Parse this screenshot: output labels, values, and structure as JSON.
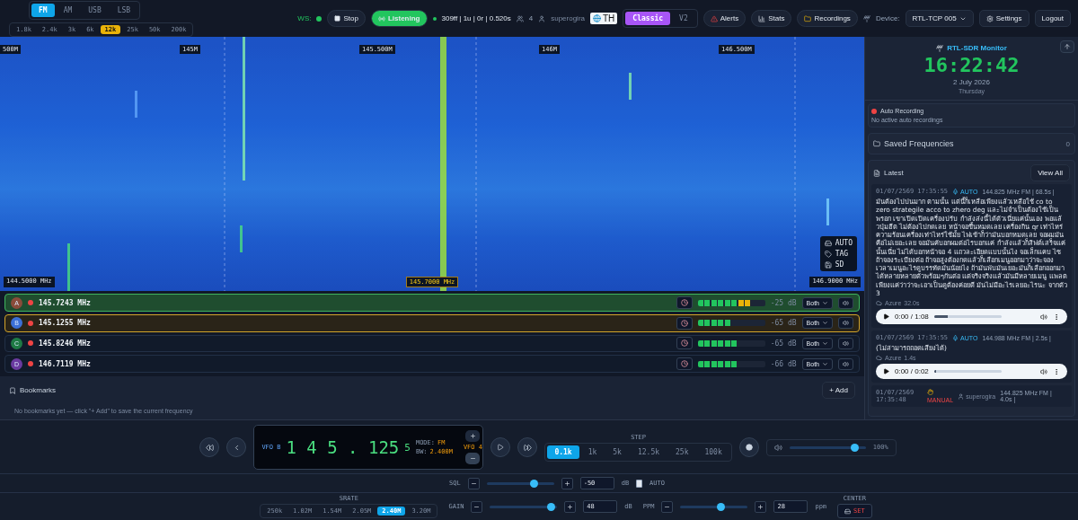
{
  "top_bar": {
    "modes": [
      {
        "label": "FM",
        "selected": true
      },
      {
        "label": "AM",
        "selected": false
      },
      {
        "label": "USB",
        "selected": false
      },
      {
        "label": "LSB",
        "selected": false
      }
    ],
    "bandwidths": [
      {
        "label": "1.8k",
        "selected": false
      },
      {
        "label": "2.4k",
        "selected": false
      },
      {
        "label": "3k",
        "selected": false
      },
      {
        "label": "6k",
        "selected": false
      },
      {
        "label": "12k",
        "selected": true
      },
      {
        "label": "25k",
        "selected": false
      },
      {
        "label": "50k",
        "selected": false
      },
      {
        "label": "200k",
        "selected": false
      }
    ],
    "ws": {
      "label": "WS:",
      "connected": true
    },
    "stop_button": "Stop",
    "listening_button": {
      "label": "Listening",
      "on": true
    },
    "stats": "309ff | 1u | 0r | 0.520s",
    "listeners": "4",
    "user": "superogira",
    "language": "TH",
    "ui_modes": [
      {
        "label": "Classic",
        "selected": true
      },
      {
        "label": "V2",
        "selected": false
      }
    ],
    "alerts_button": "Alerts",
    "stats_button": "Stats",
    "recordings_button": "Recordings",
    "device_label": "Device:",
    "device": "RTL-TCP 005",
    "settings_button": "Settings",
    "logout_button": "Logout"
  },
  "waterfall": {
    "scale_ticks": [
      "500M",
      "145M",
      "145.500M",
      "146M",
      "146.500M"
    ],
    "range_labels": [
      "144.5000 MHz",
      "145.7000 MHz",
      "146.9000 MHz"
    ],
    "legend": [
      "AUTO",
      "TAG",
      "SD"
    ]
  },
  "vfos": [
    {
      "letter": "A",
      "color": "#8a4b3a",
      "frequency": "145.7243 MHz",
      "recording": true,
      "squelch_open": true,
      "selected": false,
      "level": 0.8,
      "reading": "-25 dB",
      "output": "Both"
    },
    {
      "letter": "B",
      "color": "#3b6fd6",
      "frequency": "145.1255 MHz",
      "recording": true,
      "squelch_open": false,
      "selected": true,
      "level": 0.5,
      "reading": "-65 dB",
      "output": "Both"
    },
    {
      "letter": "C",
      "color": "#1e7a44",
      "frequency": "145.8246 MHz",
      "recording": true,
      "squelch_open": false,
      "selected": false,
      "level": 0.6,
      "reading": "-65 dB",
      "output": "Both"
    },
    {
      "letter": "D",
      "color": "#6a3aa0",
      "frequency": "146.7119 MHz",
      "recording": true,
      "squelch_open": false,
      "selected": false,
      "level": 0.6,
      "reading": "-66 dB",
      "output": "Both"
    }
  ],
  "bookmarks": {
    "title": "Bookmarks",
    "add_button": "+ Add",
    "empty_text": "No bookmarks yet — click \"+ Add\" to save the current frequency"
  },
  "sidebar": {
    "title": "RTL-SDR Monitor",
    "time": "16:22:42",
    "date": "2 July 2026",
    "weekday": "Thursday",
    "auto_recording": {
      "title": "Auto Recording",
      "active": true,
      "status": "No active auto recordings"
    },
    "saved_frequencies": {
      "title": "Saved Frequencies",
      "count": "0"
    },
    "latest": {
      "title": "Latest",
      "view_all": "View All",
      "items": [
        {
          "time": "01/07/2569 17:35:55",
          "kind": "auto",
          "source": "AUTO",
          "meta": "144.825 MHz FM | 68.5s |",
          "transcript": "มันต้องไปปนมาก ตามนั้น แต่นี้ก็เหลือเพียงแล้วเหลือใช้ co to zero strategile acco to zhero deg และไม่จำเป็นต้องใช้เป็นพรอก เขาเปิดเปิดเครื่องปรับ กำลังส่งนี้ได้ตัวเนี่ยแค่นั้นเอง พอแล้วปุ่มฮีต ไม่ต้องไปกดเลย หน้าจอขึ้นหมดเลย เครื่องกิน qr เท่าไหร่ความร้อนเครื่องเท่าไหร่ใช้มั้ย ไฟเข้าก็ว่ามันบอกหมดเลย จอผมมันคือไม่เยอะเลย จอมันคับอกผมต่อไรบอกแค่ กำลังแล้วก็สิฟต์เสร็จแค่นั้นเนี่ย ไม่ได้บอกหน้าจอ 4 แถวละเอียดแบบนั้นไง จอเล็กแคบ ไซ ถ้าจองระเบียงต่อ ถ้าจอสูงต้องกดแล้วก็เลือกเมนูออกมาว่าจะจองเวลาเมนูอะไรดูบรรทัดมันน้อยไง ถ้ามันพับมันเยอะมันก็เลือกออกมาได้หลายหลายตัวพร้อมๆกันต่อ แต่จริงจริงแล้วมันมีหลายเมนู แพลตเพียงแค่ว่าว่าจะเอาเป็นดูต้องค่อยดี มันไม่มีอะไรเลยอะไรนะ จากตัว 3",
          "engine": "Azure",
          "duration": "32.0s",
          "player": "0:00 / 1:08",
          "level": 0.2
        },
        {
          "time": "01/07/2569 17:35:55",
          "kind": "auto",
          "source": "AUTO",
          "meta": "144.988 MHz FM | 2.5s |",
          "transcript": "(ไม่สามารถถอดเสียงได้)",
          "engine": "Azure",
          "duration": "1.4s",
          "player": "0:00 / 0:02",
          "level": 0
        },
        {
          "time": "01/07/2569 17:35:48",
          "kind": "manual",
          "source": "MANUAL",
          "user": "superogira",
          "meta": "144.825 MHz FM | 4.0s |"
        }
      ]
    }
  },
  "tuner": {
    "vfo_label": "VFO B",
    "digits": "1 4 5 . 125",
    "sub_digit": "5",
    "mode_label": "MODE:",
    "mode": "FM",
    "bw_label": "BW:",
    "bw": "2.400M",
    "vfo_count": "VFO 4",
    "step_label": "STEP",
    "steps": [
      {
        "label": "0.1k",
        "selected": true
      },
      {
        "label": "1k",
        "selected": false
      },
      {
        "label": "5k",
        "selected": false
      },
      {
        "label": "12.5k",
        "selected": false
      },
      {
        "label": "25k",
        "selected": false
      },
      {
        "label": "100k",
        "selected": false
      }
    ],
    "volume": {
      "level": 0.85,
      "reading": "100%"
    }
  },
  "squelch": {
    "label": "SQL",
    "level": 0.7,
    "value": "-50",
    "unit": "dB",
    "auto_label": "AUTO",
    "auto": false
  },
  "srate": {
    "label": "SRATE",
    "options": [
      {
        "label": "250k",
        "selected": false
      },
      {
        "label": "1.02M",
        "selected": false
      },
      {
        "label": "1.54M",
        "selected": false
      },
      {
        "label": "2.05M",
        "selected": false
      },
      {
        "label": "2.40M",
        "selected": true
      },
      {
        "label": "3.20M",
        "selected": false
      }
    ]
  },
  "gain": {
    "label": "GAIN",
    "level": 0.9,
    "value": "48",
    "unit": "dB"
  },
  "ppm": {
    "label": "PPM",
    "level": 0.6,
    "value": "28",
    "unit": "ppm"
  },
  "center": {
    "label": "CENTER",
    "button": "SET"
  }
}
